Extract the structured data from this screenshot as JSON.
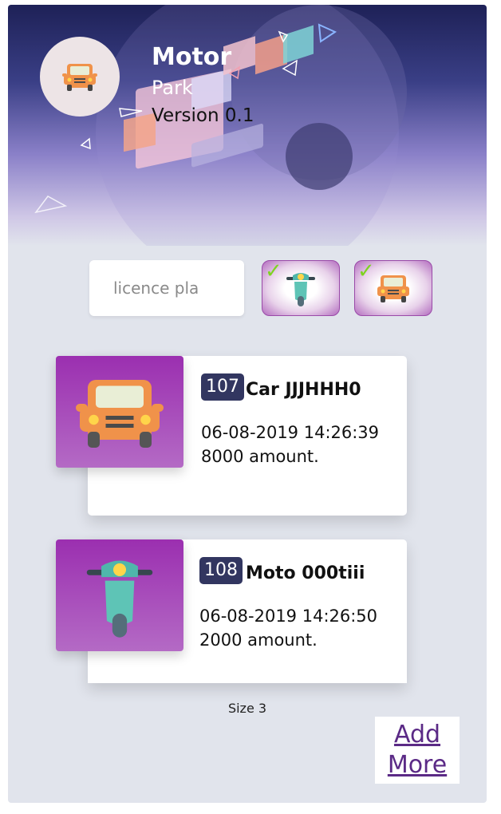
{
  "header": {
    "title": "Motor",
    "subtitle": "Park",
    "version": "Version 0.1",
    "logo_icon": "car-icon"
  },
  "search": {
    "placeholder": "licence pla",
    "value": ""
  },
  "filters": [
    {
      "icon": "scooter-icon",
      "checked": true
    },
    {
      "icon": "car-icon",
      "checked": true
    }
  ],
  "records": [
    {
      "id": "107",
      "title": "Car JJJHHH0",
      "datetime": "06-08-2019 14:26:39",
      "amount": "8000 amount.",
      "icon": "car-icon"
    },
    {
      "id": "108",
      "title": "Moto 000tiii",
      "datetime": "06-08-2019 14:26:50",
      "amount": "2000 amount.",
      "icon": "scooter-icon"
    }
  ],
  "footer": {
    "size_label": "Size 3",
    "add_more_label": "Add More"
  },
  "colors": {
    "accent": "#9b2fb0",
    "badge": "#323660",
    "background": "#e1e4ec",
    "check": "#7ed321"
  }
}
